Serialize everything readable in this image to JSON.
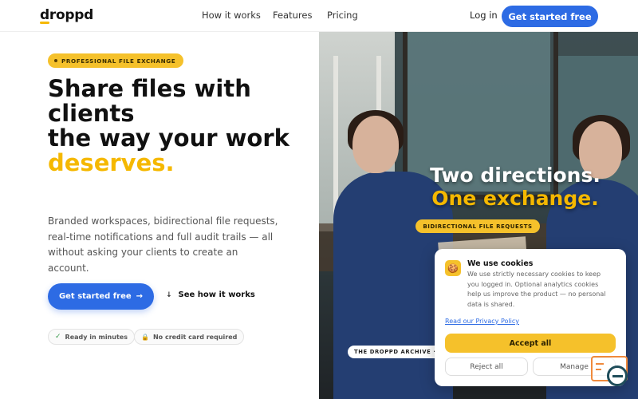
{
  "header": {
    "logo": "droppd",
    "nav": [
      "How it works",
      "Features",
      "Pricing"
    ],
    "login": "Log in",
    "cta": "Get started free"
  },
  "hero": {
    "pill": "PROFESSIONAL FILE EXCHANGE",
    "headline_line1": "Share files with clients",
    "headline_line2": "the way your work",
    "headline_accent": "deserves.",
    "subtext": "Branded workspaces, bidirectional file requests, real-time notifications and full audit trails — all without asking your clients to create an account.",
    "cta_primary": "Get started free",
    "cta_primary_arrow": "→",
    "cta_secondary_arrow": "↓",
    "cta_secondary": "See how it works",
    "badges": [
      {
        "icon": "✓",
        "label": "Ready in minutes"
      },
      {
        "icon": "🔒",
        "label": "No credit card required"
      }
    ]
  },
  "photo": {
    "title_line1": "Two directions.",
    "title_line2": "One exchange.",
    "pill": "BIDIRECTIONAL FILE REQUESTS",
    "archive_tag": "THE DROPPD ARCHIVE · C"
  },
  "cookie": {
    "icon": "🍪",
    "title": "We use cookies",
    "text": "We use strictly necessary cookies to keep you logged in. Optional analytics cookies help us improve the product — no personal data is shared.",
    "link": "Read our Privacy Policy",
    "accept": "Accept all",
    "reject": "Reject all",
    "manage": "Manage"
  },
  "colors": {
    "brand_blue": "#2d6be4",
    "accent_yellow": "#f5c12b"
  }
}
